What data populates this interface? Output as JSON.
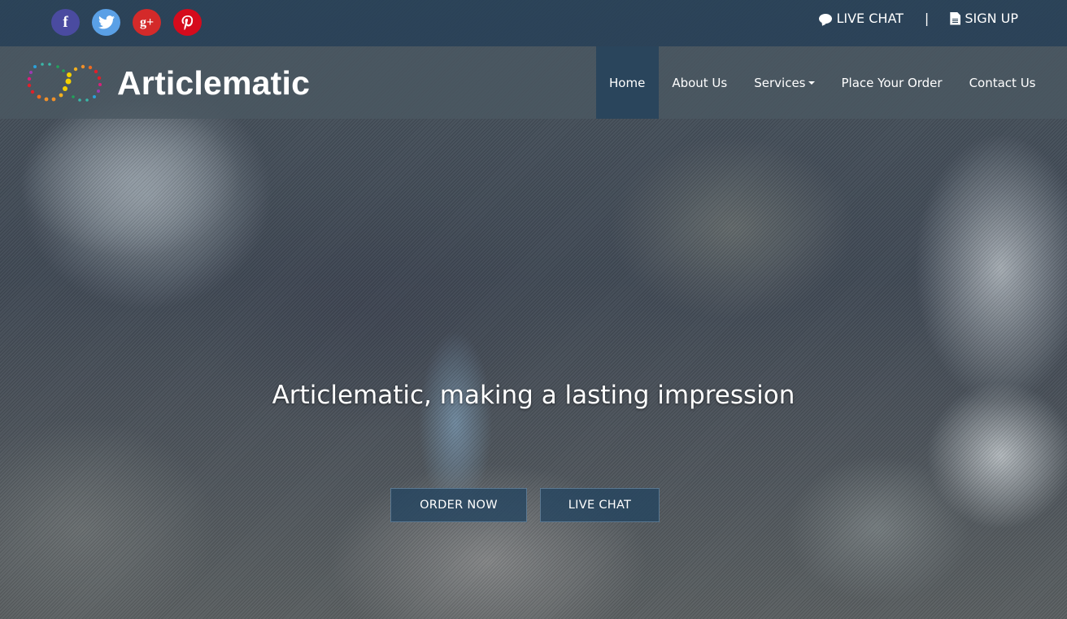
{
  "topbar": {
    "social": [
      {
        "name": "facebook",
        "glyph": "f",
        "color": "#4a4ba0"
      },
      {
        "name": "twitter",
        "glyph": "🐦",
        "color": "#5aa0e6"
      },
      {
        "name": "google-plus",
        "glyph": "g+",
        "color": "#d42a2a"
      },
      {
        "name": "pinterest",
        "glyph": "P",
        "color": "#d50b1c"
      }
    ],
    "live_chat_label": "LIVE CHAT",
    "separator": "|",
    "sign_up_label": "SIGN UP"
  },
  "navbar": {
    "brand": "Articlematic",
    "items": [
      {
        "label": "Home",
        "active": true
      },
      {
        "label": "About Us"
      },
      {
        "label": "Services",
        "dropdown": true
      },
      {
        "label": "Place Your Order"
      },
      {
        "label": "Contact Us"
      }
    ]
  },
  "hero": {
    "tagline": "Articlematic, making a lasting impression",
    "order_button": "ORDER NOW",
    "chat_button": "LIVE CHAT"
  },
  "colors": {
    "topbar": "#2b4459",
    "active_nav": "#2a455c",
    "button_bg": "#264660"
  }
}
